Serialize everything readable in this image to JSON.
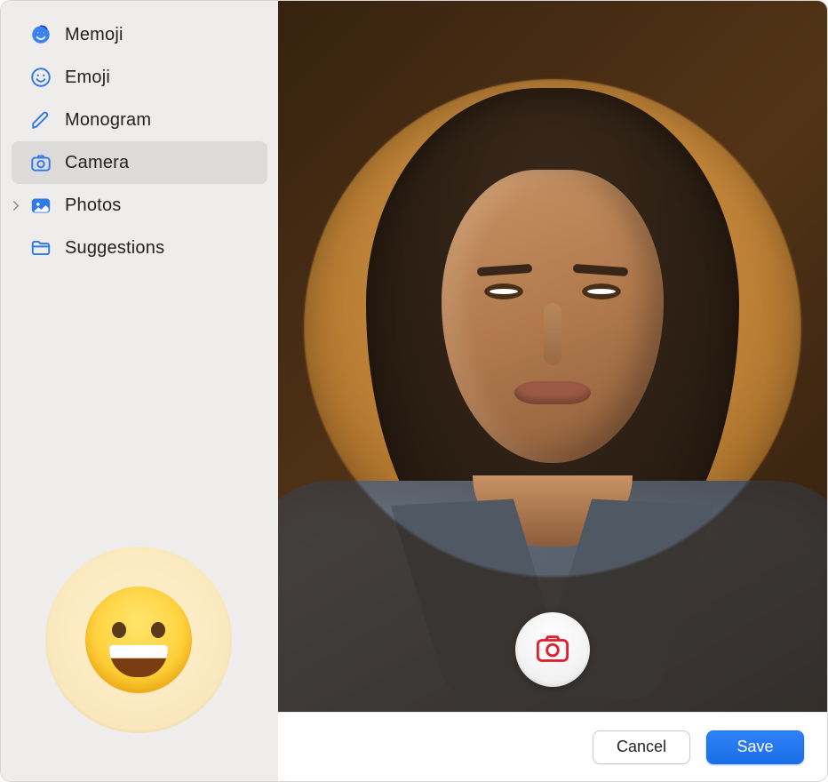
{
  "sidebar": {
    "items": [
      {
        "id": "memoji",
        "label": "Memoji",
        "icon_name": "memoji-face-icon",
        "selected": false,
        "has_children": false
      },
      {
        "id": "emoji",
        "label": "Emoji",
        "icon_name": "emoji-smile-icon",
        "selected": false,
        "has_children": false
      },
      {
        "id": "monogram",
        "label": "Monogram",
        "icon_name": "pencil-icon",
        "selected": false,
        "has_children": false
      },
      {
        "id": "camera",
        "label": "Camera",
        "icon_name": "camera-icon",
        "selected": true,
        "has_children": false
      },
      {
        "id": "photos",
        "label": "Photos",
        "icon_name": "photos-icon",
        "selected": false,
        "has_children": true
      },
      {
        "id": "suggestions",
        "label": "Suggestions",
        "icon_name": "folder-icon",
        "selected": false,
        "has_children": false
      }
    ]
  },
  "preview": {
    "current_avatar_type": "emoji",
    "current_avatar_name": "grinning-face"
  },
  "camera": {
    "capture_button_label": "Take Photo",
    "capture_icon_name": "camera-shutter-icon"
  },
  "footer": {
    "cancel_label": "Cancel",
    "save_label": "Save"
  },
  "colors": {
    "accent": "#1f73eb",
    "sidebar_bg": "#eeedec",
    "selected_bg": "#dcdbda"
  }
}
